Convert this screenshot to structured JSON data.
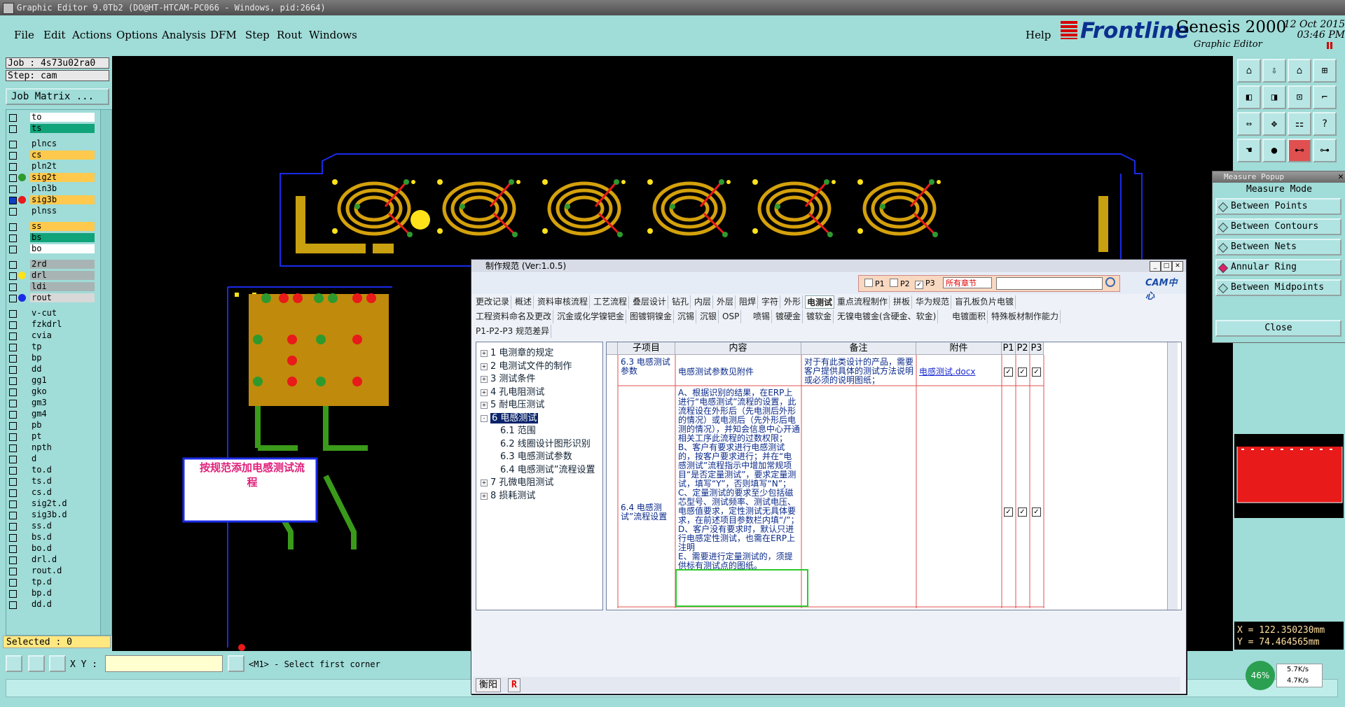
{
  "titlebar": {
    "text": "Graphic Editor 9.0Tb2 (DO@HT-HTCAM-PC066 - Windows, pid:2664)"
  },
  "menu": {
    "items": [
      "File",
      "Edit",
      "Actions",
      "Options",
      "Analysis",
      "DFM",
      "Step",
      "Rout",
      "Windows"
    ],
    "help": "Help"
  },
  "logo": {
    "brand": "Frontline",
    "product": "Genesis 2000",
    "subtitle": "Graphic Editor",
    "date": "12 Oct 2015",
    "time": "03:46 PM"
  },
  "job": {
    "job": "Job : 4s73u02ra0",
    "step": "Step: cam",
    "matrix_button": "Job Matrix ..."
  },
  "layers": [
    {
      "name": "to",
      "color": "#ffffff",
      "sel": false,
      "dot": ""
    },
    {
      "name": "ts",
      "color": "#11a37a",
      "sel": false,
      "dot": ""
    },
    {
      "name": "plncs",
      "color": "#a0dcd8",
      "sel": false,
      "dot": ""
    },
    {
      "name": "cs",
      "color": "#ffc94d",
      "sel": false,
      "dot": ""
    },
    {
      "name": "pln2t",
      "color": "#a0dcd8",
      "sel": false,
      "dot": ""
    },
    {
      "name": "sig2t",
      "color": "#ffc94d",
      "sel": false,
      "dot": "#2e9a2e"
    },
    {
      "name": "pln3b",
      "color": "#a0dcd8",
      "sel": false,
      "dot": ""
    },
    {
      "name": "sig3b",
      "color": "#ffc94d",
      "sel": true,
      "dot": "#e81a1a"
    },
    {
      "name": "plnss",
      "color": "#a0dcd8",
      "sel": false,
      "dot": ""
    },
    {
      "name": "ss",
      "color": "#ffc94d",
      "sel": false,
      "dot": ""
    },
    {
      "name": "bs",
      "color": "#11a37a",
      "sel": false,
      "dot": ""
    },
    {
      "name": "bo",
      "color": "#ffffff",
      "sel": false,
      "dot": ""
    },
    {
      "name": "2rd",
      "color": "#a8b4b4",
      "sel": false,
      "dot": ""
    },
    {
      "name": "drl",
      "color": "#a8b4b4",
      "sel": false,
      "dot": "#ffe21a"
    },
    {
      "name": "ldi",
      "color": "#a8b4b4",
      "sel": false,
      "dot": ""
    },
    {
      "name": "rout",
      "color": "#d8d8d8",
      "sel": false,
      "dot": "#1a2ae8"
    },
    {
      "name": "v-cut",
      "color": "#a0dcd8",
      "sel": false,
      "dot": ""
    },
    {
      "name": "fzkdrl",
      "color": "#a0dcd8",
      "sel": false,
      "dot": ""
    },
    {
      "name": "cvia",
      "color": "#a0dcd8",
      "sel": false,
      "dot": ""
    },
    {
      "name": "tp",
      "color": "#a0dcd8",
      "sel": false,
      "dot": ""
    },
    {
      "name": "bp",
      "color": "#a0dcd8",
      "sel": false,
      "dot": ""
    },
    {
      "name": "dd",
      "color": "#a0dcd8",
      "sel": false,
      "dot": ""
    },
    {
      "name": "gg1",
      "color": "#a0dcd8",
      "sel": false,
      "dot": ""
    },
    {
      "name": "gko",
      "color": "#a0dcd8",
      "sel": false,
      "dot": ""
    },
    {
      "name": "gm3",
      "color": "#a0dcd8",
      "sel": false,
      "dot": ""
    },
    {
      "name": "gm4",
      "color": "#a0dcd8",
      "sel": false,
      "dot": ""
    },
    {
      "name": "pb",
      "color": "#a0dcd8",
      "sel": false,
      "dot": ""
    },
    {
      "name": "pt",
      "color": "#a0dcd8",
      "sel": false,
      "dot": ""
    },
    {
      "name": "npth",
      "color": "#a0dcd8",
      "sel": false,
      "dot": ""
    },
    {
      "name": "d",
      "color": "#a0dcd8",
      "sel": false,
      "dot": ""
    },
    {
      "name": "to.d",
      "color": "#a0dcd8",
      "sel": false,
      "dot": ""
    },
    {
      "name": "ts.d",
      "color": "#a0dcd8",
      "sel": false,
      "dot": ""
    },
    {
      "name": "cs.d",
      "color": "#a0dcd8",
      "sel": false,
      "dot": ""
    },
    {
      "name": "sig2t.d",
      "color": "#a0dcd8",
      "sel": false,
      "dot": ""
    },
    {
      "name": "sig3b.d",
      "color": "#a0dcd8",
      "sel": false,
      "dot": ""
    },
    {
      "name": "ss.d",
      "color": "#a0dcd8",
      "sel": false,
      "dot": ""
    },
    {
      "name": "bs.d",
      "color": "#a0dcd8",
      "sel": false,
      "dot": ""
    },
    {
      "name": "bo.d",
      "color": "#a0dcd8",
      "sel": false,
      "dot": ""
    },
    {
      "name": "drl.d",
      "color": "#a0dcd8",
      "sel": false,
      "dot": ""
    },
    {
      "name": "rout.d",
      "color": "#a0dcd8",
      "sel": false,
      "dot": ""
    },
    {
      "name": "tp.d",
      "color": "#a0dcd8",
      "sel": false,
      "dot": ""
    },
    {
      "name": "bp.d",
      "color": "#a0dcd8",
      "sel": false,
      "dot": ""
    },
    {
      "name": "dd.d",
      "color": "#a0dcd8",
      "sel": false,
      "dot": ""
    }
  ],
  "selected_label": "Selected : 0",
  "annotation_text": "按规范添加电感测试流程",
  "measure": {
    "title": "Measure Popup",
    "header": "Measure Mode",
    "options": [
      "Between Points",
      "Between Contours",
      "Between Nets",
      "Annular Ring",
      "Between Midpoints"
    ],
    "active": "Annular Ring",
    "close": "Close"
  },
  "coords": {
    "x": "X = 122.350230mm",
    "y": "Y = 74.464565mm"
  },
  "bottom": {
    "xy_label": "X Y :",
    "prompt": "<M1> - Select first corner",
    "zoom_badge": "46%",
    "net_up": "5.7K/s",
    "net_down": "4.7K/s"
  },
  "doc": {
    "title": "制作规范 (Ver:1.0.5)",
    "filter": {
      "p1": "P1",
      "p2": "P2",
      "p3": "P3",
      "scope": "所有章节"
    },
    "cam_logo": "CAM中心",
    "tabs_row1": [
      "更改记录",
      "概述",
      "资料审核流程",
      "工艺流程",
      "叠层设计",
      "钻孔",
      "内层",
      "外层",
      "阻焊",
      "字符",
      "外形",
      "电测试",
      "重点流程制作",
      "拼板",
      "华为规范",
      "盲孔板负片电镀"
    ],
    "tabs_row2": [
      "工程资料命名及更改",
      "沉金或化学镍钯金",
      "图镀铜镍金",
      "沉锡",
      "沉银",
      "OSP",
      "喷锡",
      "镀硬金",
      "镀软金",
      "无镍电镀金(含硬金、软金)",
      "电镀面积",
      "特殊板材制作能力"
    ],
    "tabs_row3": [
      "P1-P2-P3 规范差异"
    ],
    "active_tab": "电测试",
    "tree": [
      {
        "label": "1 电测章的规定",
        "level": 0,
        "pm": "+"
      },
      {
        "label": "2 电测试文件的制作",
        "level": 0,
        "pm": "+"
      },
      {
        "label": "3 测试条件",
        "level": 0,
        "pm": "+"
      },
      {
        "label": "4 孔电阻测试",
        "level": 0,
        "pm": "+"
      },
      {
        "label": "5 耐电压测试",
        "level": 0,
        "pm": "+"
      },
      {
        "label": "6 电感测试",
        "level": 0,
        "pm": "-",
        "sel": true
      },
      {
        "label": "6.1 范围",
        "level": 1
      },
      {
        "label": "6.2 线圈设计图形识别",
        "level": 1
      },
      {
        "label": "6.3 电感测试参数",
        "level": 1
      },
      {
        "label": "6.4 电感测试”流程设置",
        "level": 1
      },
      {
        "label": "7 孔微电阻测试",
        "level": 0,
        "pm": "+"
      },
      {
        "label": "8 损耗测试",
        "level": 0,
        "pm": "+"
      }
    ],
    "table": {
      "headers": [
        "子项目",
        "内容",
        "备注",
        "附件",
        "P1",
        "P2",
        "P3"
      ],
      "rows": [
        {
          "sub": "6.3 电感测试参数",
          "content": "电感测试参数见附件",
          "note": "对于有此类设计的产品，需要客户提供具体的测试方法说明或必须的说明图纸；",
          "attach": "电感测试.docx"
        },
        {
          "sub": "6.4 电感测试”流程设置",
          "content": "A、根据识别的结果，在ERP上进行“电感测试”流程的设置，此流程设在外形后（先电测后外形的情况）或电测后（先外形后电测的情况），并知会信息中心开通相关工序此流程的过数权限；\nB、客户有要求进行电感测试的，按客户要求进行；并在“电感测试”流程指示中增加常规项目“是否定量测试”，要求定量测试，填写“Y”，否则填写“N”；\nC、定量测试的要求至少包括磁芯型号、测试频率、测试电压、电感值要求，定性测试无具体要求，在前述项目参数栏内填“/”；\nD、客户没有要求时，默认只进行电感定性测试，也需在ERP上注明\nE、需要进行定量测试的，须提供标有测试点的图纸。",
          "note": "",
          "attach": ""
        }
      ]
    },
    "bottom_buttons": [
      "衡阳",
      "R"
    ]
  }
}
